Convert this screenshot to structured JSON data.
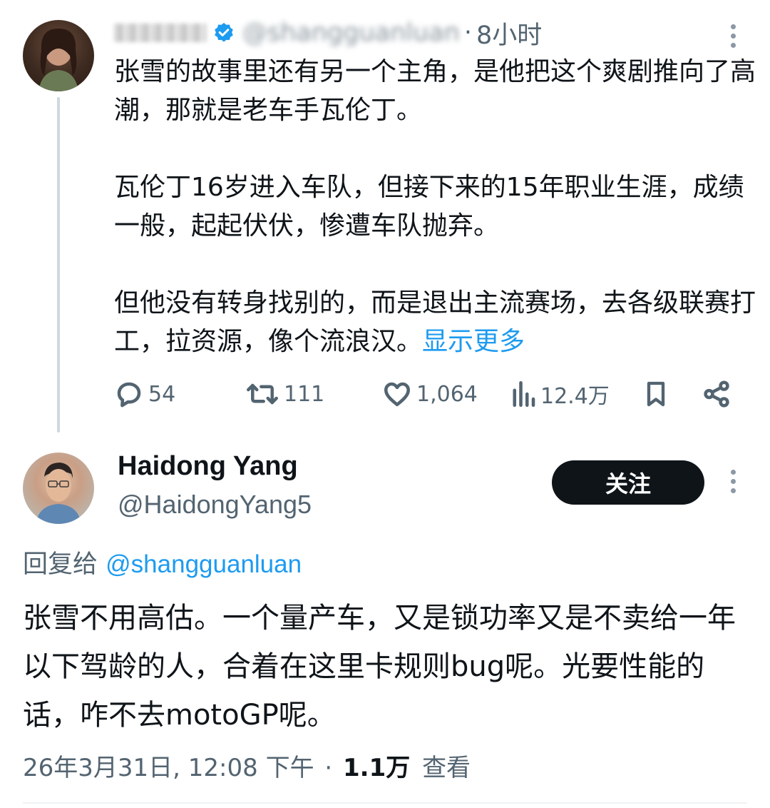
{
  "parent_tweet": {
    "handle": "@shangguanluan",
    "separator": "·",
    "time": "8小时",
    "text_paragraphs": [
      "张雪的故事里还有另一个主角，是他把这个爽剧推向了高潮，那就是老车手瓦伦丁。",
      "瓦伦丁16岁进入车队，但接下来的15年职业生涯，成绩一般，起起伏伏，惨遭车队抛弃。",
      "但他没有转身找别的，而是退出主流赛场，去各级联赛打工，拉资源，像个流浪汉。"
    ],
    "show_more": "显示更多",
    "actions": {
      "replies": "54",
      "retweets": "111",
      "likes": "1,064",
      "views": "12.4万"
    }
  },
  "reply_tweet": {
    "display_name": "Haidong Yang",
    "handle": "@HaidongYang5",
    "follow_label": "关注",
    "reply_to_prefix": "回复给",
    "reply_to_handle": "@shangguanluan",
    "text": "张雪不用高估。一个量产车，又是锁功率又是不卖给一年以下驾龄的人，合着在这里卡规则bug呢。光要性能的话，咋不去motoGP呢。",
    "date_time": "26年3月31日, 12:08 下午",
    "separator": "·",
    "view_count": "1.1万",
    "view_label": "查看"
  },
  "colors": {
    "link": "#1d9bf0",
    "secondary_text": "#536471",
    "primary_text": "#0f1419",
    "follow_button_bg": "#0f1419"
  },
  "icons": [
    "verified-badge-icon",
    "more-options-icon",
    "reply-icon",
    "retweet-icon",
    "like-icon",
    "views-icon",
    "bookmark-icon",
    "share-icon"
  ]
}
